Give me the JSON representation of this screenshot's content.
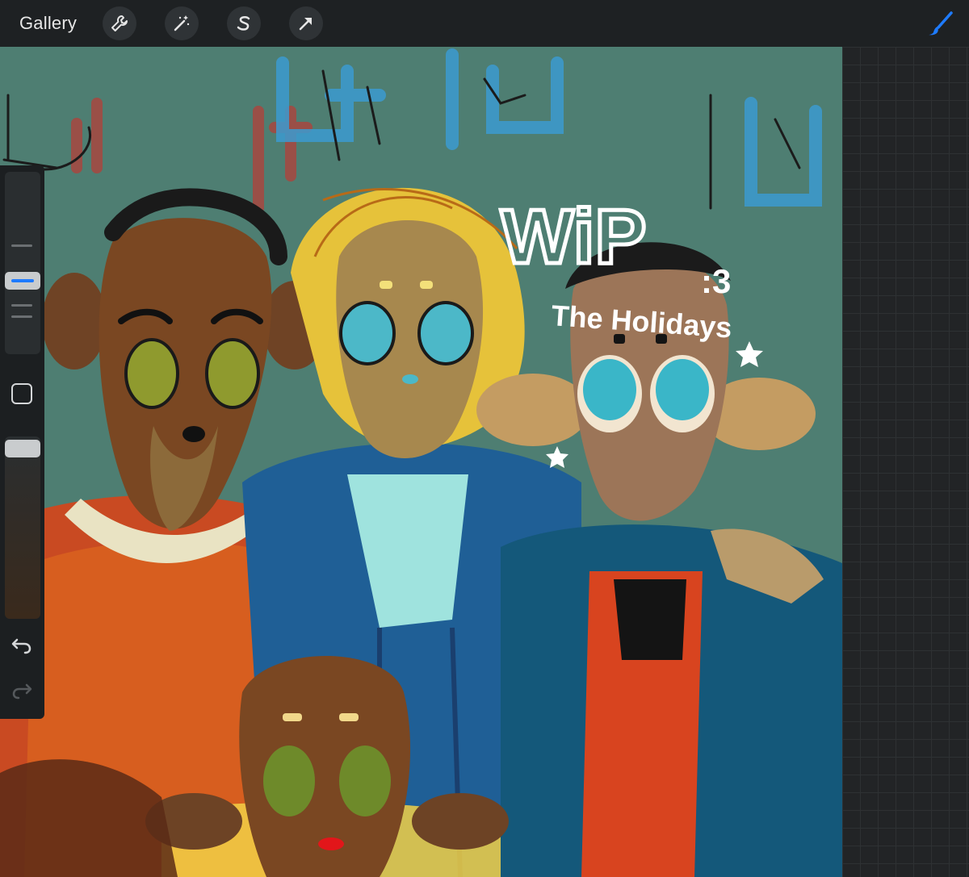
{
  "toolbar": {
    "gallery_label": "Gallery",
    "tools": [
      "wrench-icon",
      "magic-wand-icon",
      "selection-s-icon",
      "transform-arrow-icon"
    ],
    "active_tool": "brush-icon",
    "accent": "#1e7bff"
  },
  "artwork": {
    "wip_text": "WiP",
    "smiley_text": ":3",
    "subtitle_text": "The Holidays"
  },
  "sidebar": {
    "undo_icon": "undo-icon",
    "redo_icon": "redo-icon",
    "modify_icon": "square-modify-icon"
  }
}
